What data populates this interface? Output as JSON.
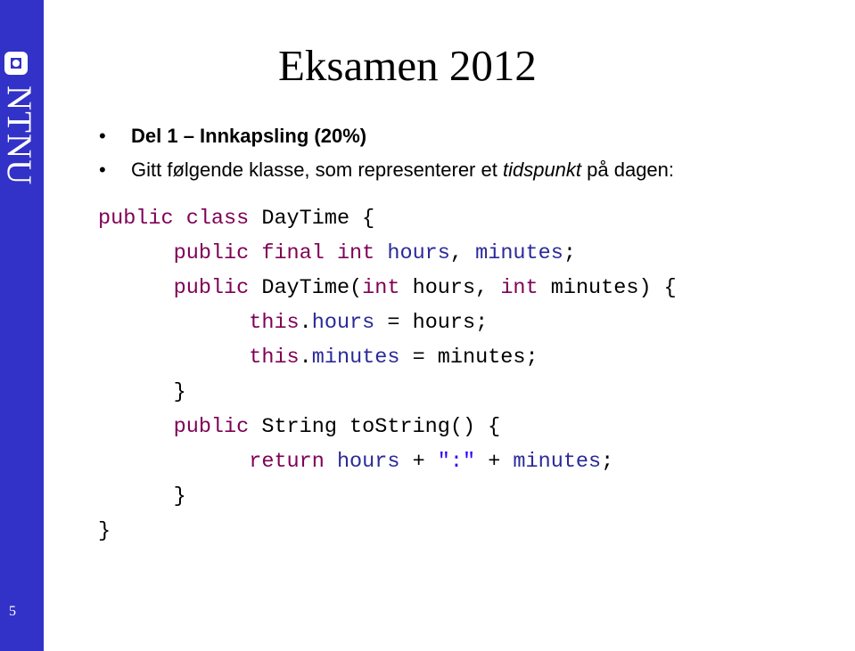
{
  "sidebar": {
    "brand": "NTNU",
    "page_number": "5",
    "accent_color": "#3232c8"
  },
  "slide": {
    "title": "Eksamen 2012",
    "bullets": [
      {
        "marker": "•",
        "text": "Del 1 – Innkapsling (20%)"
      },
      {
        "marker": "•",
        "text_before": "Gitt følgende klasse, som representerer et ",
        "text_italic": "tidspunkt",
        "text_after": " på dagen:"
      }
    ]
  },
  "code": {
    "lines": [
      [
        {
          "t": "public class ",
          "c": "kw"
        },
        {
          "t": "DayTime {",
          "c": "plain"
        }
      ],
      [
        {
          "t": "      ",
          "c": "plain"
        },
        {
          "t": "public final int ",
          "c": "kw"
        },
        {
          "t": "hours",
          "c": "id"
        },
        {
          "t": ", ",
          "c": "plain"
        },
        {
          "t": "minutes",
          "c": "id"
        },
        {
          "t": ";",
          "c": "plain"
        }
      ],
      [
        {
          "t": "      ",
          "c": "plain"
        },
        {
          "t": "public ",
          "c": "kw"
        },
        {
          "t": "DayTime(",
          "c": "plain"
        },
        {
          "t": "int ",
          "c": "kw"
        },
        {
          "t": "hours, ",
          "c": "plain"
        },
        {
          "t": "int ",
          "c": "kw"
        },
        {
          "t": "minutes) {",
          "c": "plain"
        }
      ],
      [
        {
          "t": "            ",
          "c": "plain"
        },
        {
          "t": "this",
          "c": "kw"
        },
        {
          "t": ".",
          "c": "plain"
        },
        {
          "t": "hours",
          "c": "id"
        },
        {
          "t": " = hours;",
          "c": "plain"
        }
      ],
      [
        {
          "t": "            ",
          "c": "plain"
        },
        {
          "t": "this",
          "c": "kw"
        },
        {
          "t": ".",
          "c": "plain"
        },
        {
          "t": "minutes",
          "c": "id"
        },
        {
          "t": " = minutes;",
          "c": "plain"
        }
      ],
      [
        {
          "t": "      }",
          "c": "plain"
        }
      ],
      [
        {
          "t": "      ",
          "c": "plain"
        },
        {
          "t": "public ",
          "c": "kw"
        },
        {
          "t": "String toString() {",
          "c": "plain"
        }
      ],
      [
        {
          "t": "            ",
          "c": "plain"
        },
        {
          "t": "return ",
          "c": "kw"
        },
        {
          "t": "hours",
          "c": "id"
        },
        {
          "t": " + ",
          "c": "plain"
        },
        {
          "t": "\":\"",
          "c": "str"
        },
        {
          "t": " + ",
          "c": "plain"
        },
        {
          "t": "minutes",
          "c": "id"
        },
        {
          "t": ";",
          "c": "plain"
        }
      ],
      [
        {
          "t": "      }",
          "c": "plain"
        }
      ],
      [
        {
          "t": "}",
          "c": "plain"
        }
      ]
    ]
  }
}
